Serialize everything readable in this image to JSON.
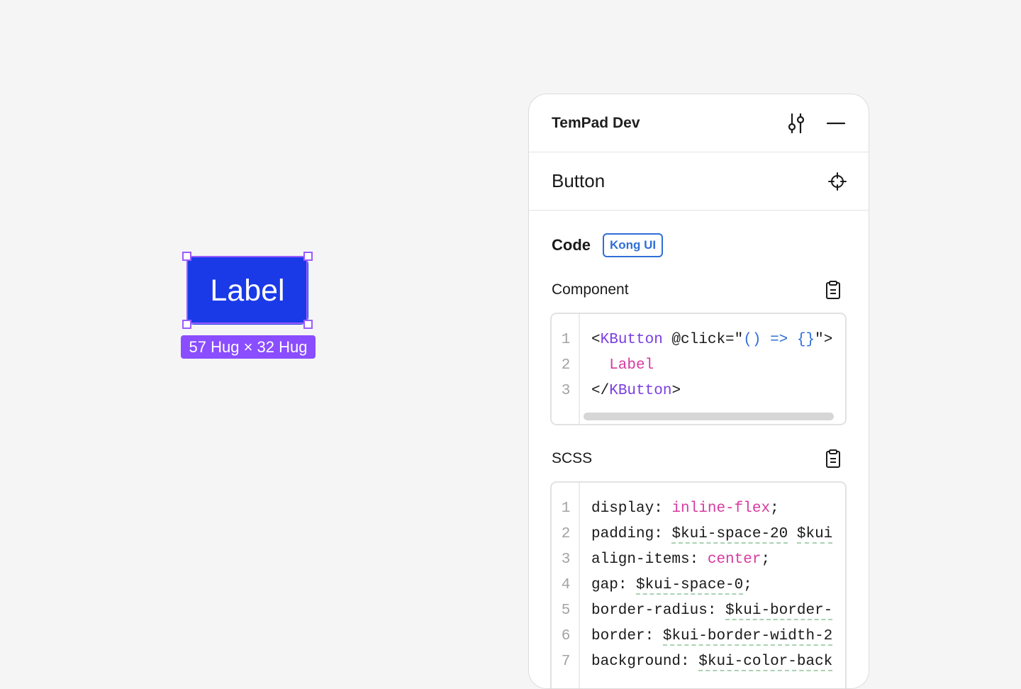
{
  "canvas": {
    "button_label": "Label",
    "size_badge": "57 Hug × 32 Hug"
  },
  "panel": {
    "title": "TemPad Dev",
    "settings_icon": "sliders-icon",
    "minimize_icon": "minus-icon",
    "node_title": "Button",
    "locate_icon": "crosshair-icon",
    "code_label": "Code",
    "code_badge": "Kong UI",
    "component": {
      "label": "Component",
      "copy_icon": "clipboard-icon",
      "line_numbers": [
        "1",
        "2",
        "3"
      ],
      "lines": [
        [
          {
            "t": "<",
            "c": "punct"
          },
          {
            "t": "KButton",
            "c": "tag"
          },
          {
            "t": " @click",
            "c": "attr"
          },
          {
            "t": "=\"",
            "c": "punct"
          },
          {
            "t": "() => {}",
            "c": "expr"
          },
          {
            "t": "\">",
            "c": "punct"
          }
        ],
        [
          {
            "t": "  Label",
            "c": "txt"
          }
        ],
        [
          {
            "t": "</",
            "c": "punct"
          },
          {
            "t": "KButton",
            "c": "tag"
          },
          {
            "t": ">",
            "c": "punct"
          }
        ]
      ]
    },
    "scss": {
      "label": "SCSS",
      "copy_icon": "clipboard-icon",
      "line_numbers": [
        "1",
        "2",
        "3",
        "4",
        "5",
        "6",
        "7"
      ],
      "lines": [
        [
          {
            "t": "display",
            "c": "attr"
          },
          {
            "t": ": ",
            "c": "punct"
          },
          {
            "t": "inline-flex",
            "c": "val"
          },
          {
            "t": ";",
            "c": "punct"
          }
        ],
        [
          {
            "t": "padding",
            "c": "attr"
          },
          {
            "t": ": ",
            "c": "punct"
          },
          {
            "t": "$kui-space-20",
            "c": "var"
          },
          {
            "t": " ",
            "c": "punct"
          },
          {
            "t": "$kui",
            "c": "var"
          }
        ],
        [
          {
            "t": "align-items",
            "c": "attr"
          },
          {
            "t": ": ",
            "c": "punct"
          },
          {
            "t": "center",
            "c": "val"
          },
          {
            "t": ";",
            "c": "punct"
          }
        ],
        [
          {
            "t": "gap",
            "c": "attr"
          },
          {
            "t": ": ",
            "c": "punct"
          },
          {
            "t": "$kui-space-0",
            "c": "var"
          },
          {
            "t": ";",
            "c": "punct"
          }
        ],
        [
          {
            "t": "border-radius",
            "c": "attr"
          },
          {
            "t": ": ",
            "c": "punct"
          },
          {
            "t": "$kui-border-",
            "c": "var"
          }
        ],
        [
          {
            "t": "border",
            "c": "attr"
          },
          {
            "t": ": ",
            "c": "punct"
          },
          {
            "t": "$kui-border-width-2",
            "c": "var"
          }
        ],
        [
          {
            "t": "background",
            "c": "attr"
          },
          {
            "t": ": ",
            "c": "punct"
          },
          {
            "t": "$kui-color-back",
            "c": "var"
          }
        ]
      ]
    }
  },
  "colors": {
    "button_bg": "#1a3ae8",
    "selection": "#9b5cff",
    "size_badge_bg": "#8a4dff",
    "badge_border": "#2f6fd8",
    "tag": "#7a3fe0",
    "string_value": "#d63aa0"
  }
}
